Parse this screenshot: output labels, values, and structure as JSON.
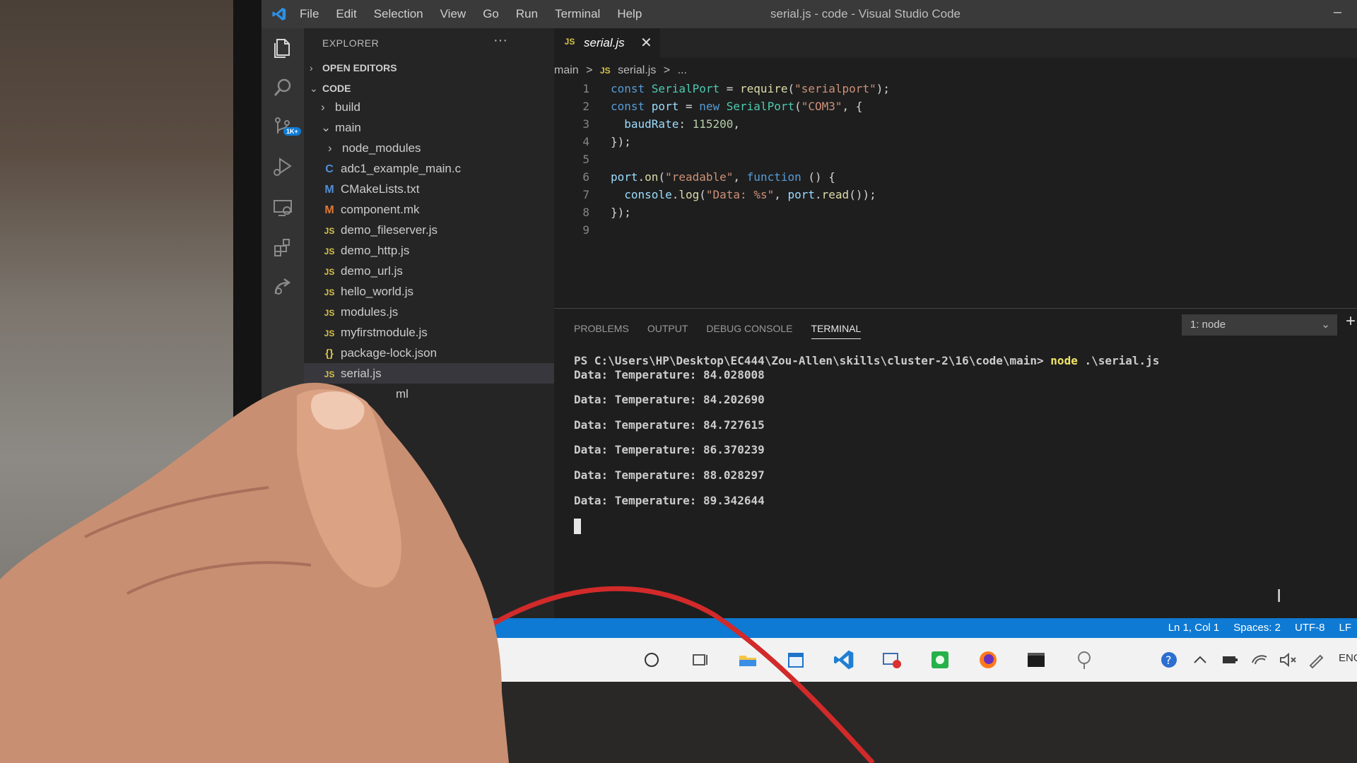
{
  "titlebar": {
    "menu": [
      "File",
      "Edit",
      "Selection",
      "View",
      "Go",
      "Run",
      "Terminal",
      "Help"
    ],
    "window_title": "serial.js - code - Visual Studio Code"
  },
  "activity_bar": {
    "items": [
      "explorer-icon",
      "search-icon",
      "source-control-icon",
      "run-debug-icon",
      "remote-explorer-icon",
      "extensions-icon",
      "live-share-icon"
    ],
    "scm_badge": "1K+"
  },
  "sidebar": {
    "title": "EXPLORER",
    "more": "···",
    "open_editors": "OPEN EDITORS",
    "workspace": "CODE",
    "tree": [
      {
        "label": "build",
        "type": "folder",
        "expanded": false
      },
      {
        "label": "main",
        "type": "folder",
        "expanded": true
      },
      {
        "label": "node_modules",
        "type": "folder",
        "expanded": false
      },
      {
        "label": "adc1_example_main.c",
        "icon": "C"
      },
      {
        "label": "CMakeLists.txt",
        "icon": "M"
      },
      {
        "label": "component.mk",
        "icon": "M"
      },
      {
        "label": "demo_fileserver.js",
        "icon": "JS"
      },
      {
        "label": "demo_http.js",
        "icon": "JS"
      },
      {
        "label": "demo_url.js",
        "icon": "JS"
      },
      {
        "label": "hello_world.js",
        "icon": "JS"
      },
      {
        "label": "modules.js",
        "icon": "JS"
      },
      {
        "label": "myfirstmodule.js",
        "icon": "JS"
      },
      {
        "label": "package-lock.json",
        "icon": "{}"
      },
      {
        "label": "serial.js",
        "icon": "JS",
        "selected": true
      },
      {
        "label": "ml",
        "icon": ""
      }
    ]
  },
  "editor": {
    "tab": {
      "icon": "JS",
      "label": "serial.js",
      "close": "✕"
    },
    "breadcrumb": [
      "main",
      ">",
      "JS",
      "serial.js",
      ">",
      "..."
    ],
    "lines": [
      {
        "n": "1",
        "parts": [
          [
            "kw",
            "const "
          ],
          [
            "cls",
            "SerialPort"
          ],
          [
            "pun",
            " = "
          ],
          [
            "fn",
            "require"
          ],
          [
            "pun",
            "("
          ],
          [
            "str",
            "\"serialport\""
          ],
          [
            "pun",
            ");"
          ]
        ]
      },
      {
        "n": "2",
        "parts": [
          [
            "kw",
            "const "
          ],
          [
            "prop",
            "port"
          ],
          [
            "pun",
            " = "
          ],
          [
            "kw",
            "new "
          ],
          [
            "cls",
            "SerialPort"
          ],
          [
            "pun",
            "("
          ],
          [
            "str",
            "\"COM3\""
          ],
          [
            "pun",
            ", {"
          ]
        ]
      },
      {
        "n": "3",
        "parts": [
          [
            "pun",
            "  "
          ],
          [
            "prop",
            "baudRate"
          ],
          [
            "pun",
            ": "
          ],
          [
            "num",
            "115200"
          ],
          [
            "pun",
            ","
          ]
        ]
      },
      {
        "n": "4",
        "parts": [
          [
            "pun",
            "});"
          ]
        ]
      },
      {
        "n": "5",
        "parts": []
      },
      {
        "n": "6",
        "parts": [
          [
            "prop",
            "port"
          ],
          [
            "pun",
            "."
          ],
          [
            "fn",
            "on"
          ],
          [
            "pun",
            "("
          ],
          [
            "str",
            "\"readable\""
          ],
          [
            "pun",
            ", "
          ],
          [
            "kw",
            "function"
          ],
          [
            "pun",
            " () {"
          ]
        ]
      },
      {
        "n": "7",
        "parts": [
          [
            "pun",
            "  "
          ],
          [
            "prop",
            "console"
          ],
          [
            "pun",
            "."
          ],
          [
            "fn",
            "log"
          ],
          [
            "pun",
            "("
          ],
          [
            "str",
            "\"Data: %s\""
          ],
          [
            "pun",
            ", "
          ],
          [
            "prop",
            "port"
          ],
          [
            "pun",
            "."
          ],
          [
            "fn",
            "read"
          ],
          [
            "pun",
            "());"
          ]
        ]
      },
      {
        "n": "8",
        "parts": [
          [
            "pun",
            "});"
          ]
        ]
      },
      {
        "n": "9",
        "parts": []
      }
    ]
  },
  "panel": {
    "tabs": [
      "PROBLEMS",
      "OUTPUT",
      "DEBUG CONSOLE",
      "TERMINAL"
    ],
    "active_tab": "TERMINAL",
    "terminal_select": "1: node",
    "new_terminal": "+",
    "prompt": "PS C:\\Users\\HP\\Desktop\\EC444\\Zou-Allen\\skills\\cluster-2\\16\\code\\main> ",
    "command": "node",
    "command_arg": " .\\serial.js",
    "output": [
      "Data: Temperature: 84.028008",
      "Data: Temperature: 84.202690",
      "Data: Temperature: 84.727615",
      "Data: Temperature: 86.370239",
      "Data: Temperature: 88.028297",
      "Data: Temperature: 89.342644"
    ]
  },
  "statusbar": {
    "position": "Ln 1, Col 1",
    "spaces": "Spaces: 2",
    "encoding": "UTF-8",
    "eol": "LF"
  },
  "taskbar": {
    "items": [
      "cortana-icon",
      "task-view-icon",
      "file-explorer-icon",
      "calendar-icon",
      "vscode-icon",
      "screen-record-icon",
      "app-green-icon",
      "firefox-icon",
      "terminal-icon",
      "network-app-icon"
    ],
    "tray_lang": "ENG"
  },
  "colors": {
    "accent": "#0e7ad3",
    "editor_bg": "#1e1e1e",
    "sidebar_bg": "#252526",
    "terminal_command": "#f0e46a"
  }
}
